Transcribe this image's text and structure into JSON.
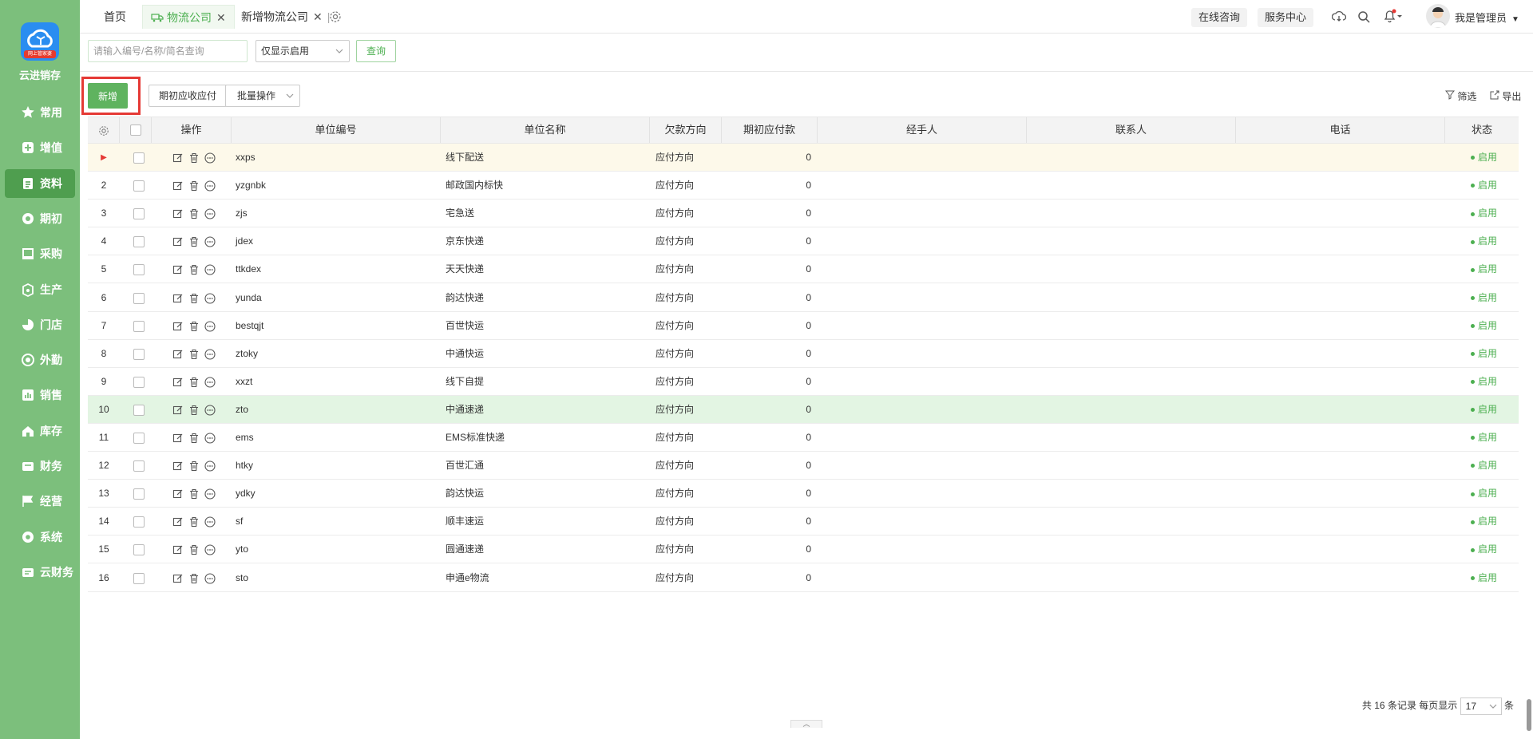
{
  "brand": {
    "name": "云进销存",
    "logo_badge": "网上管家婆"
  },
  "nav": [
    {
      "label": "常用",
      "icon": "star-icon"
    },
    {
      "label": "增值",
      "icon": "plus-square-icon"
    },
    {
      "label": "资料",
      "icon": "document-icon",
      "active": true
    },
    {
      "label": "期初",
      "icon": "target-icon"
    },
    {
      "label": "采购",
      "icon": "cart-icon"
    },
    {
      "label": "生产",
      "icon": "box-icon"
    },
    {
      "label": "门店",
      "icon": "pie-icon"
    },
    {
      "label": "外勤",
      "icon": "location-icon"
    },
    {
      "label": "销售",
      "icon": "chart-icon"
    },
    {
      "label": "库存",
      "icon": "home-icon"
    },
    {
      "label": "财务",
      "icon": "wallet-icon"
    },
    {
      "label": "经营",
      "icon": "flag-icon"
    },
    {
      "label": "系统",
      "icon": "gear-icon"
    },
    {
      "label": "云财务",
      "icon": "cloud-icon"
    }
  ],
  "tabs": [
    {
      "label": "首页"
    },
    {
      "label": "物流公司",
      "active": true,
      "closable": true
    },
    {
      "label": "新增物流公司",
      "closable": true
    }
  ],
  "header": {
    "consult": "在线咨询",
    "service": "服务中心",
    "user": "我是管理员"
  },
  "search": {
    "placeholder": "请输入编号/名称/简名查询",
    "filter": "仅显示启用",
    "query": "查询"
  },
  "toolbar": {
    "add": "新增",
    "initial": "期初应收应付",
    "batch": "批量操作",
    "filter": "筛选",
    "export": "导出"
  },
  "columns": [
    "操作",
    "单位编号",
    "单位名称",
    "欠款方向",
    "期初应付款",
    "经手人",
    "联系人",
    "电话",
    "状态"
  ],
  "rows": [
    {
      "no": "▶",
      "code": "xxps",
      "name": "线下配送",
      "dir": "应付方向",
      "amt": "0",
      "status": "启用"
    },
    {
      "no": "2",
      "code": "yzgnbk",
      "name": "邮政国内标快",
      "dir": "应付方向",
      "amt": "0",
      "status": "启用"
    },
    {
      "no": "3",
      "code": "zjs",
      "name": "宅急送",
      "dir": "应付方向",
      "amt": "0",
      "status": "启用"
    },
    {
      "no": "4",
      "code": "jdex",
      "name": "京东快递",
      "dir": "应付方向",
      "amt": "0",
      "status": "启用"
    },
    {
      "no": "5",
      "code": "ttkdex",
      "name": "天天快递",
      "dir": "应付方向",
      "amt": "0",
      "status": "启用"
    },
    {
      "no": "6",
      "code": "yunda",
      "name": "韵达快递",
      "dir": "应付方向",
      "amt": "0",
      "status": "启用"
    },
    {
      "no": "7",
      "code": "bestqjt",
      "name": "百世快运",
      "dir": "应付方向",
      "amt": "0",
      "status": "启用"
    },
    {
      "no": "8",
      "code": "ztoky",
      "name": "中通快运",
      "dir": "应付方向",
      "amt": "0",
      "status": "启用"
    },
    {
      "no": "9",
      "code": "xxzt",
      "name": "线下自提",
      "dir": "应付方向",
      "amt": "0",
      "status": "启用"
    },
    {
      "no": "10",
      "code": "zto",
      "name": "中通速递",
      "dir": "应付方向",
      "amt": "0",
      "status": "启用"
    },
    {
      "no": "11",
      "code": "ems",
      "name": "EMS标准快递",
      "dir": "应付方向",
      "amt": "0",
      "status": "启用"
    },
    {
      "no": "12",
      "code": "htky",
      "name": "百世汇通",
      "dir": "应付方向",
      "amt": "0",
      "status": "启用"
    },
    {
      "no": "13",
      "code": "ydky",
      "name": "韵达快运",
      "dir": "应付方向",
      "amt": "0",
      "status": "启用"
    },
    {
      "no": "14",
      "code": "sf",
      "name": "顺丰速运",
      "dir": "应付方向",
      "amt": "0",
      "status": "启用"
    },
    {
      "no": "15",
      "code": "yto",
      "name": "圆通速递",
      "dir": "应付方向",
      "amt": "0",
      "status": "启用"
    },
    {
      "no": "16",
      "code": "sto",
      "name": "申通e物流",
      "dir": "应付方向",
      "amt": "0",
      "status": "启用"
    }
  ],
  "pager": {
    "prefix": "共",
    "total": "16",
    "mid": "条记录 每页显示",
    "size": "17",
    "suffix": "条"
  },
  "colors": {
    "sidebar": "#7cbf7c",
    "accent": "#4caf50",
    "highlight": "#e53935"
  }
}
